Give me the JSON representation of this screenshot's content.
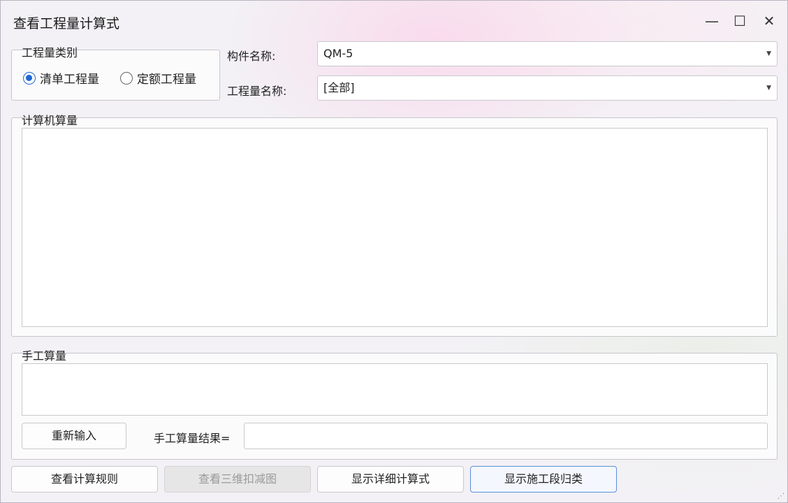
{
  "window": {
    "title": "查看工程量计算式",
    "minimize_glyph": "—",
    "maximize_glyph": "☐",
    "close_glyph": "✕"
  },
  "category": {
    "legend": "工程量类别",
    "options": [
      {
        "label": "清单工程量",
        "checked": true
      },
      {
        "label": "定额工程量",
        "checked": false
      }
    ]
  },
  "component": {
    "label": "构件名称:",
    "value": "QM-5"
  },
  "quantity_name": {
    "label": "工程量名称:",
    "value": "[全部]"
  },
  "computer_calc": {
    "legend": "计算机算量",
    "content": ""
  },
  "manual_calc": {
    "legend": "手工算量",
    "content": "",
    "reset_label": "重新输入",
    "result_label": "手工算量结果=",
    "result_value": ""
  },
  "footer": {
    "view_rules": "查看计算规则",
    "view_3d": "查看三维扣减图",
    "show_detail": "显示详细计算式",
    "show_stage": "显示施工段归类"
  },
  "icons": {
    "dropdown": "chevron-down-icon",
    "resize": "resize-grip-icon"
  },
  "colors": {
    "accent": "#1f67d2",
    "focus_border": "#5b8fd9"
  }
}
